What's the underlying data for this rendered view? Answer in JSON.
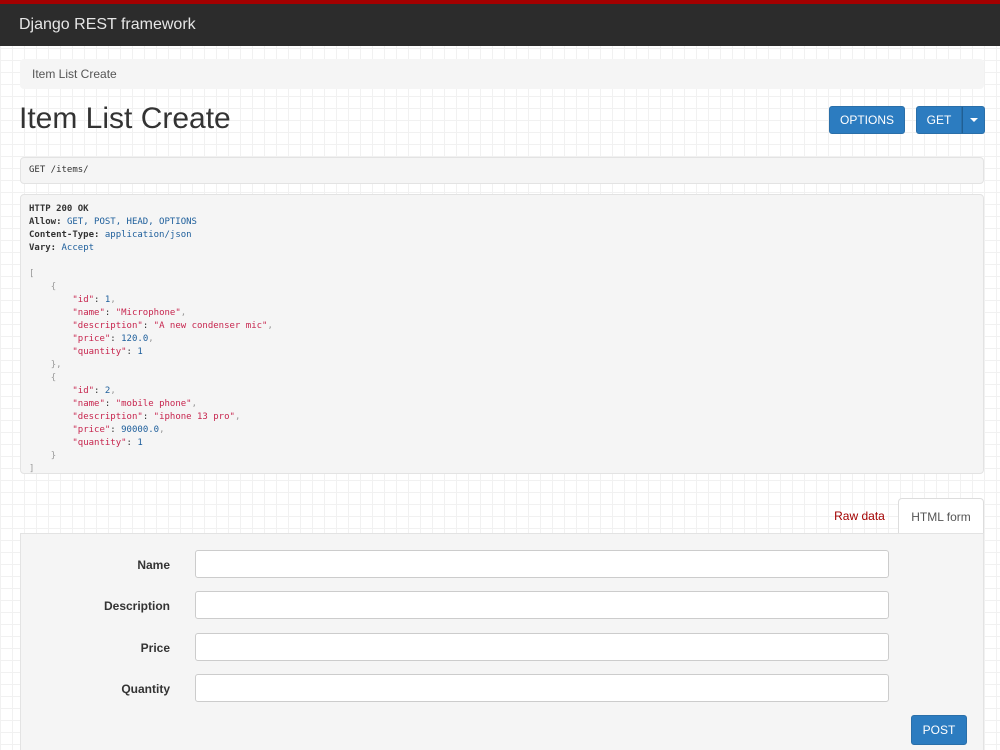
{
  "navbar": {
    "brand": "Django REST framework"
  },
  "breadcrumb": {
    "item": "Item List Create"
  },
  "page": {
    "title": "Item List Create"
  },
  "toolbar": {
    "options_label": "OPTIONS",
    "get_label": "GET"
  },
  "request": {
    "line": "GET /items/"
  },
  "response": {
    "status": "HTTP 200 OK",
    "headers": [
      {
        "key": "Allow:",
        "value": "GET, POST, HEAD, OPTIONS"
      },
      {
        "key": "Content-Type:",
        "value": "application/json"
      },
      {
        "key": "Vary:",
        "value": "Accept"
      }
    ],
    "items": [
      {
        "id": "1",
        "name": "\"Microphone\"",
        "description": "\"A new condenser mic\"",
        "price": "120.0",
        "quantity": "1"
      },
      {
        "id": "2",
        "name": "\"mobile phone\"",
        "description": "\"iphone 13 pro\"",
        "price": "90000.0",
        "quantity": "1"
      }
    ],
    "keys": {
      "id": "\"id\"",
      "name": "\"name\"",
      "description": "\"description\"",
      "price": "\"price\"",
      "quantity": "\"quantity\""
    },
    "punct": {
      "open_list": "[",
      "close_list": "]",
      "open_obj": "{",
      "close_obj": "}",
      "close_obj_comma": "},",
      "colon": ": ",
      "comma": ","
    }
  },
  "tabs": {
    "raw": "Raw data",
    "html": "HTML form"
  },
  "form": {
    "fields": [
      {
        "label": "Name",
        "value": ""
      },
      {
        "label": "Description",
        "value": ""
      },
      {
        "label": "Price",
        "value": ""
      },
      {
        "label": "Quantity",
        "value": ""
      }
    ],
    "submit_label": "POST"
  },
  "colors": {
    "navbar": "#2c2c2c",
    "accent_bar": "#a30000",
    "button": "#2c7cc0",
    "tab_link": "#a30000"
  }
}
